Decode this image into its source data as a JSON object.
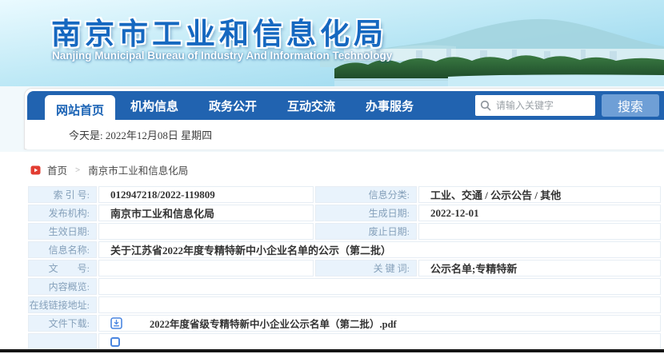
{
  "header": {
    "title": "南京市工业和信息化局",
    "subtitle": "Nanjing Municipal Bureau of Industry And Information Technology"
  },
  "nav": {
    "tabs": [
      {
        "label": "网站首页",
        "active": true
      },
      {
        "label": "机构信息",
        "active": false
      },
      {
        "label": "政务公开",
        "active": false
      },
      {
        "label": "互动交流",
        "active": false
      },
      {
        "label": "办事服务",
        "active": false
      }
    ],
    "search": {
      "placeholder": "请输入关键字",
      "button_label": "搜索"
    },
    "date_line": "今天是: 2022年12月08日  星期四"
  },
  "breadcrumb": {
    "home": "首页",
    "separator": ">",
    "current": "南京市工业和信息化局"
  },
  "info_table": {
    "rows": [
      {
        "label": "索 引 号:",
        "value": "012947218/2022-119809",
        "label2": "信息分类:",
        "value2": "工业、交通 / 公示公告 / 其他"
      },
      {
        "label": "发布机构:",
        "value": "南京市工业和信息化局",
        "label2": "生成日期:",
        "value2": "2022-12-01"
      },
      {
        "label": "生效日期:",
        "value": "",
        "label2": "废止日期:",
        "value2": ""
      },
      {
        "label": "信息名称:",
        "value": "关于江苏省2022年度专精特新中小企业名单的公示（第二批）"
      },
      {
        "label": "文　　号:",
        "value": "",
        "label2": "关 键 词:",
        "value2": "公示名单;专精特新"
      },
      {
        "label": "内容概览:",
        "value": ""
      },
      {
        "label": "在线链接地址:",
        "value": ""
      },
      {
        "label": "文件下载:",
        "value": "2022年度省级专精特新中小企业公示名单（第二批）.pdf"
      }
    ]
  },
  "icons": {
    "breadcrumb_icon": "red-play-square",
    "search_icon": "magnifier",
    "download_icon": "download-arrow-box"
  },
  "colors": {
    "nav_blue": "#2163b0",
    "search_button_blue": "#6f9fd6",
    "label_cell_bg": "#e9f3fc",
    "breadcrumb_icon_red": "#e23d32",
    "download_icon_blue": "#4a86e0",
    "title_blue": "#1668c0"
  }
}
